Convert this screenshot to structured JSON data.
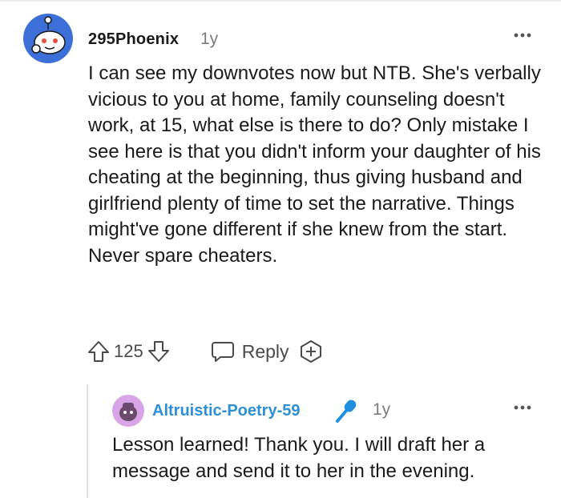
{
  "comment": {
    "username": "295Phoenix",
    "age": "1y",
    "body": "I can see my downvotes now but NTB. She's verbally vicious to you at home, family counseling doesn't work, at 15, what else is there to do? Only mistake I see here is that you didn't inform your daughter of his cheating at the beginning, thus giving husband and girlfriend plenty of time to set the narrative. Things might've gone different if she knew from the start. Never spare cheaters.",
    "score": "125",
    "reply_label": "Reply",
    "icons": {
      "avatar": "snoo-avatar-icon",
      "upvote": "upvote-arrow-icon",
      "downvote": "downvote-arrow-icon",
      "reply": "speech-bubble-icon",
      "award": "award-plus-icon",
      "more": "more-options-icon"
    }
  },
  "reply": {
    "username": "Altruistic-Poetry-59",
    "age": "1y",
    "body": "Lesson learned! Thank you. I will draft her a message and send it to her in the evening.",
    "icons": {
      "avatar": "snoo-avatar-icon",
      "flair": "microphone-icon",
      "more": "more-options-icon"
    }
  },
  "colors": {
    "text": "#1a1a1b",
    "muted": "#7c7c7c",
    "reply_username": "#2d8fd5",
    "avatar_main_bg": "#3d6fd8",
    "avatar_reply_bg": "#d8a6e8",
    "mic": "#1f8fe0"
  }
}
